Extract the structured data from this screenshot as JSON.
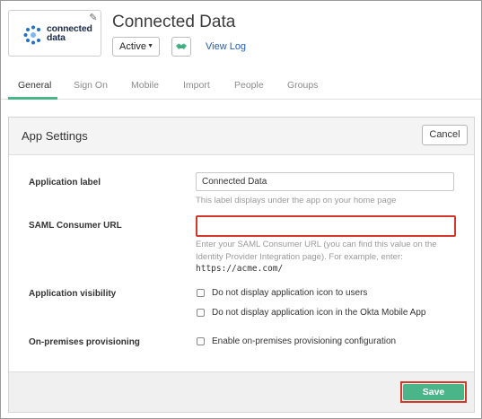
{
  "header": {
    "logo_line1": "connected",
    "logo_line2": "data",
    "app_title": "Connected Data",
    "status_value": "Active",
    "view_log": "View Log"
  },
  "tabs": [
    {
      "label": "General",
      "active": true
    },
    {
      "label": "Sign On"
    },
    {
      "label": "Mobile"
    },
    {
      "label": "Import"
    },
    {
      "label": "People"
    },
    {
      "label": "Groups"
    }
  ],
  "panel": {
    "title": "App Settings",
    "cancel_label": "Cancel",
    "app_label": {
      "label": "Application label",
      "value": "Connected Data",
      "hint": "This label displays under the app on your home page"
    },
    "saml": {
      "label": "SAML Consumer URL",
      "value": "",
      "hint_line1": "Enter your SAML Consumer URL (you can find this value on the",
      "hint_line2": "Identity Provider Integration page). For example, enter:",
      "example": "https://acme.com/"
    },
    "visibility": {
      "label": "Application visibility",
      "option1": "Do not display application icon to users",
      "option2": "Do not display application icon in the Okta Mobile App"
    },
    "onprem": {
      "label": "On-premises provisioning",
      "option": "Enable on-premises provisioning configuration"
    },
    "save_label": "Save"
  },
  "colors": {
    "accent": "#4bb58a",
    "highlight": "#d2392b",
    "link": "#1f5fb4"
  }
}
